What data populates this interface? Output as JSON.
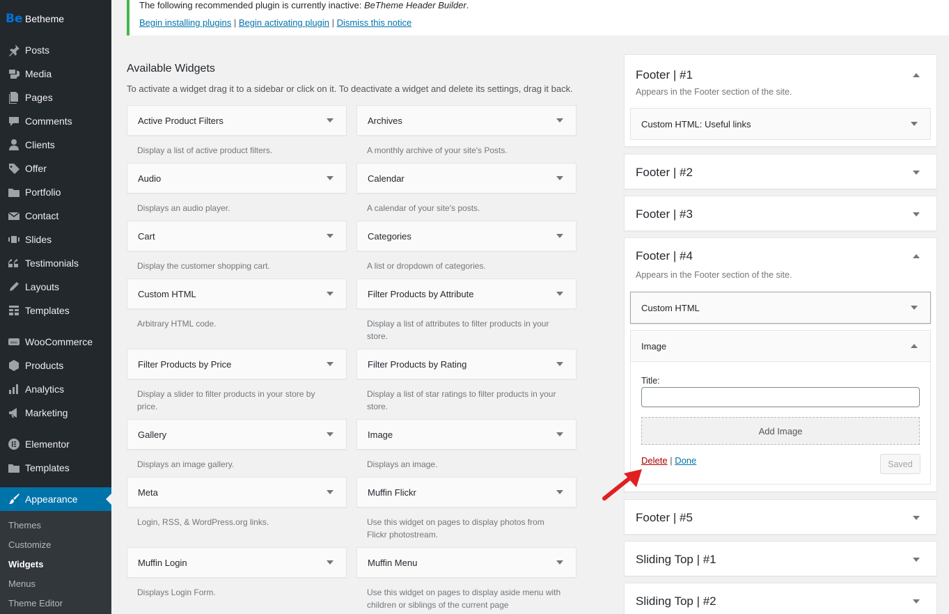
{
  "brand": {
    "logo": "Be",
    "name": "Betheme"
  },
  "menu": [
    {
      "label": "Posts",
      "icon": "pushpin-icon"
    },
    {
      "label": "Media",
      "icon": "media-icon"
    },
    {
      "label": "Pages",
      "icon": "pages-icon"
    },
    {
      "label": "Comments",
      "icon": "comment-icon"
    },
    {
      "label": "Clients",
      "icon": "user-icon"
    },
    {
      "label": "Offer",
      "icon": "tag-icon"
    },
    {
      "label": "Portfolio",
      "icon": "folder-icon"
    },
    {
      "label": "Contact",
      "icon": "envelope-icon"
    },
    {
      "label": "Slides",
      "icon": "slides-icon"
    },
    {
      "label": "Testimonials",
      "icon": "quote-icon"
    },
    {
      "label": "Layouts",
      "icon": "pencil-icon"
    },
    {
      "label": "Templates",
      "icon": "grid-icon"
    },
    {
      "label": "WooCommerce",
      "icon": "woo-icon"
    },
    {
      "label": "Products",
      "icon": "box-icon"
    },
    {
      "label": "Analytics",
      "icon": "bar-chart-icon"
    },
    {
      "label": "Marketing",
      "icon": "megaphone-icon"
    },
    {
      "label": "Elementor",
      "icon": "elementor-icon"
    },
    {
      "label": "Templates",
      "icon": "folder-icon"
    },
    {
      "label": "Appearance",
      "icon": "brush-icon"
    }
  ],
  "submenu": [
    "Themes",
    "Customize",
    "Widgets",
    "Menus",
    "Theme Editor"
  ],
  "notice": {
    "message_prefix": "The following recommended plugin is currently inactive: ",
    "plugin": "BeTheme Header Builder",
    "message_suffix": ".",
    "link1": "Begin installing plugins",
    "link2": "Begin activating plugin",
    "link3": "Dismiss this notice",
    "sep": " | "
  },
  "available": {
    "title": "Available Widgets",
    "desc": "To activate a widget drag it to a sidebar or click on it. To deactivate a widget and delete its settings, drag it back.",
    "widgets": [
      {
        "name": "Active Product Filters",
        "desc": "Display a list of active product filters."
      },
      {
        "name": "Archives",
        "desc": "A monthly archive of your site's Posts."
      },
      {
        "name": "Audio",
        "desc": "Displays an audio player."
      },
      {
        "name": "Calendar",
        "desc": "A calendar of your site's posts."
      },
      {
        "name": "Cart",
        "desc": "Display the customer shopping cart."
      },
      {
        "name": "Categories",
        "desc": "A list or dropdown of categories."
      },
      {
        "name": "Custom HTML",
        "desc": "Arbitrary HTML code."
      },
      {
        "name": "Filter Products by Attribute",
        "desc": "Display a list of attributes to filter products in your store."
      },
      {
        "name": "Filter Products by Price",
        "desc": "Display a slider to filter products in your store by price."
      },
      {
        "name": "Filter Products by Rating",
        "desc": "Display a list of star ratings to filter products in your store."
      },
      {
        "name": "Gallery",
        "desc": "Displays an image gallery."
      },
      {
        "name": "Image",
        "desc": "Displays an image."
      },
      {
        "name": "Meta",
        "desc": "Login, RSS, & WordPress.org links."
      },
      {
        "name": "Muffin Flickr",
        "desc": "Use this widget on pages to display photos from Flickr photostream."
      },
      {
        "name": "Muffin Login",
        "desc": "Displays Login Form."
      },
      {
        "name": "Muffin Menu",
        "desc": "Use this widget on pages to display aside menu with children or siblings of the current page"
      }
    ]
  },
  "sidebars": {
    "footer1": {
      "title": "Footer | #1",
      "desc": "Appears in the Footer section of the site.",
      "widget": "Custom HTML: Useful links"
    },
    "footer2": {
      "title": "Footer | #2"
    },
    "footer3": {
      "title": "Footer | #3"
    },
    "footer4": {
      "title": "Footer | #4",
      "desc": "Appears in the Footer section of the site.",
      "widget1": "Custom HTML",
      "widget2": "Image",
      "form": {
        "title_label": "Title:",
        "title_value": "",
        "add_image": "Add Image",
        "delete": "Delete",
        "sep": " | ",
        "done": "Done",
        "saved": "Saved"
      }
    },
    "footer5": {
      "title": "Footer | #5"
    },
    "sliding1": {
      "title": "Sliding Top | #1"
    },
    "sliding2": {
      "title": "Sliding Top | #2"
    }
  },
  "colors": {
    "sidebar_bg": "#23282d",
    "accent": "#0073aa",
    "notice_border": "#46b450",
    "delete": "#a00",
    "arrow": "#e02020"
  }
}
